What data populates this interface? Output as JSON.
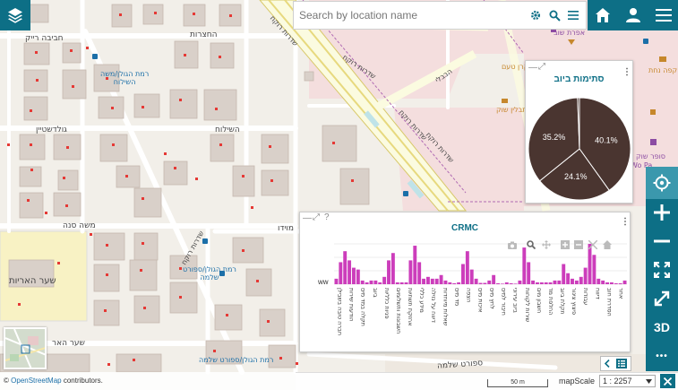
{
  "search": {
    "placeholder": "Search by location name"
  },
  "map": {
    "streets": [
      "חביבה רייק",
      "החצרות",
      "השילוח",
      "גולדשטיין",
      "משה סנה",
      "מוידו",
      "שדרות רוקח",
      "שדרות רוקח",
      "שדרות רוקח",
      "שדרות רוקח",
      "שדרות רוקח",
      "הבבלי",
      "שער האריות",
      "שער האר",
      "ספורט שלמה"
    ],
    "pois": [
      "רמת הגולן/משה\nהשילוח",
      "רמת הגולן/ספורט\nשלמה",
      "רמת הגולן/ספורט שלמה",
      "אפרת שוב",
      "קרן טעם",
      "תבלין שוק",
      "קפה נחת",
      "סופר שוק",
      "Wo Pa"
    ]
  },
  "pie_widget": {
    "title": "סתימות ביוב",
    "menu": "⋮"
  },
  "bar_widget": {
    "title": "CRMC",
    "menu": "⋮",
    "y_tick": "ww"
  },
  "attribution": {
    "prefix": "©",
    "link": "OpenStreetMap",
    "suffix": "contributors."
  },
  "scale": {
    "bar_label": "50 m",
    "label": "mapScale",
    "value": "1 : 2257"
  },
  "right_controls": {
    "three_d": "3D",
    "more": "•••"
  },
  "chart_data": [
    {
      "type": "pie",
      "title": "סתימות ביוב",
      "slices": [
        {
          "label": "40.1%",
          "value": 40.1
        },
        {
          "label": "24.1%",
          "value": 24.1
        },
        {
          "label": "35.2%",
          "value": 35.2
        },
        {
          "label": "",
          "value": 0.6
        }
      ],
      "colors": [
        "#4a3530",
        "#4a3530",
        "#4a3530",
        "#4a3530"
      ]
    },
    {
      "type": "bar",
      "title": "CRMC",
      "color": "#cc3dbb",
      "ylabel": "",
      "categories": [
        "חברה טובה בשבילן",
        "הודעות שירות",
        "תקלה במד מים",
        "ביוב",
        "פניות כלליות",
        "חשבונות ותשלומים",
        "אחזקת תשתיות",
        "מידע כללי",
        "דיווח על נזילה",
        "שאלות מיוחדות",
        "מד מים",
        "הצפה",
        "איכות מים",
        "לחץ מים",
        "חיבור למים",
        "ביוב עירוני",
        "שירות לקוחות",
        "חשבון מים",
        "החלפת מד",
        "תקלת ביוב",
        "פיצוץ צינור",
        "עבודות",
        "דיווח",
        "הסדרת חוב",
        "אחר"
      ],
      "values": [
        3,
        12,
        18,
        13,
        9,
        8,
        2,
        1,
        2,
        2,
        1,
        4,
        13,
        17,
        1,
        1,
        1,
        13,
        21,
        12,
        3,
        4,
        3,
        3,
        5,
        2,
        1,
        0.5,
        1,
        11,
        18,
        8,
        3,
        0.7,
        0.7,
        2,
        5,
        0.5,
        0.3,
        1,
        0.5,
        0.3,
        2,
        20,
        12,
        2,
        1,
        1,
        1,
        1,
        2,
        2,
        11,
        6,
        3,
        2,
        4,
        9,
        22,
        16,
        3,
        2,
        1,
        1,
        0.5,
        0.5,
        2
      ]
    }
  ]
}
